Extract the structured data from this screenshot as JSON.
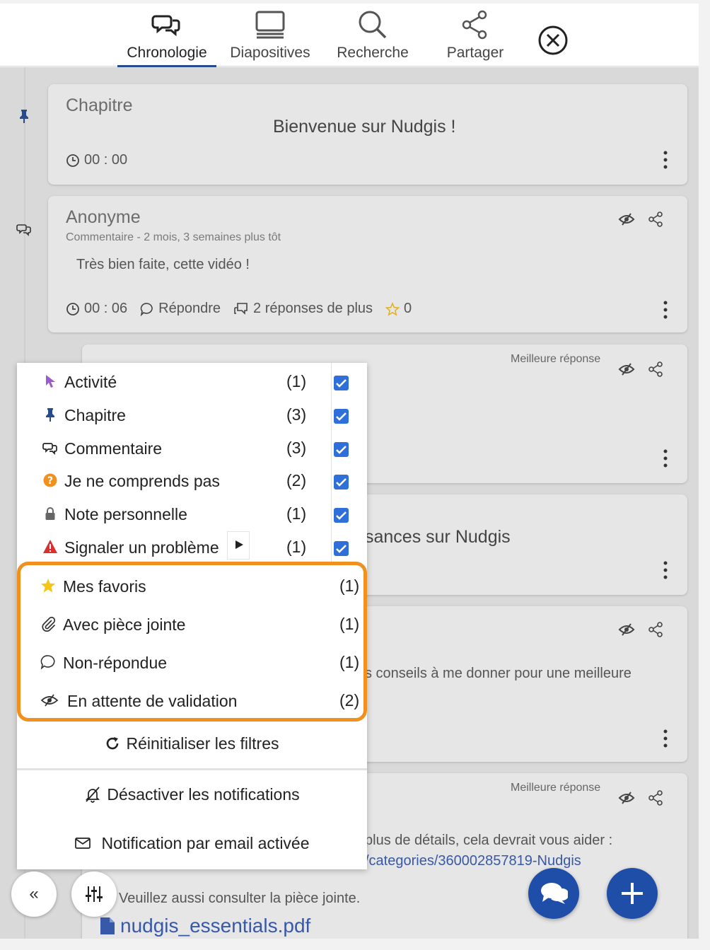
{
  "nav": {
    "tabs": [
      {
        "label": "Chronologie",
        "icon": "chat-bubbles-icon",
        "active": true
      },
      {
        "label": "Diapositives",
        "icon": "slides-icon",
        "active": false
      },
      {
        "label": "Recherche",
        "icon": "search-icon",
        "active": false
      },
      {
        "label": "Partager",
        "icon": "share-icon",
        "active": false
      }
    ],
    "close_icon": "close-circle-icon"
  },
  "cards": [
    {
      "author": "Chapitre",
      "title": "Bienvenue sur Nudgis !",
      "time": "00 : 00"
    },
    {
      "author": "Anonyme",
      "meta": "Commentaire - 2 mois, 3 semaines plus tôt",
      "text": "Très bien faite, cette vidéo !",
      "time": "00 : 06",
      "reply": "Répondre",
      "more_replies": "2 réponses de plus",
      "stars": "0"
    },
    {
      "best_answer": "Meilleure réponse"
    },
    {
      "text_fragment": "sances sur Nudgis"
    },
    {
      "text_fragment": "s conseils à me donner pour une meilleure"
    },
    {
      "best_answer": "Meilleure réponse",
      "text_line1": "plus de détails, cela devrait vous aider :",
      "link_fragment": "/categories/360002857819-Nudgis",
      "text_line3": "Veuillez aussi consulter la pièce jointe.",
      "attachment": "nudgis_essentials.pdf"
    }
  ],
  "filters": {
    "types": [
      {
        "label": "Activité",
        "count": "(1)",
        "icon": "cursor-icon",
        "checked": true
      },
      {
        "label": "Chapitre",
        "count": "(3)",
        "icon": "pin-icon",
        "checked": true
      },
      {
        "label": "Commentaire",
        "count": "(3)",
        "icon": "chat-bubbles-icon",
        "checked": true
      },
      {
        "label": "Je ne comprends pas",
        "count": "(2)",
        "icon": "question-icon",
        "checked": true
      },
      {
        "label": "Note personnelle",
        "count": "(1)",
        "icon": "lock-icon",
        "checked": true
      },
      {
        "label": "Signaler un problème",
        "count": "(1)",
        "icon": "warning-icon",
        "checked": true
      }
    ],
    "special": [
      {
        "label": "Mes favoris",
        "count": "(1)",
        "icon": "star-icon"
      },
      {
        "label": "Avec pièce jointe",
        "count": "(1)",
        "icon": "paperclip-icon"
      },
      {
        "label": "Non-répondue",
        "count": "(1)",
        "icon": "chat-bubble-icon"
      },
      {
        "label": "En attente de validation",
        "count": "(2)",
        "icon": "eye-slash-icon"
      }
    ],
    "reset_label": "Réinitialiser les filtres",
    "disable_notifications_label": "Désactiver les notifications",
    "email_notification_label": "Notification par email activée"
  },
  "colors": {
    "accent": "#1f4ea8",
    "highlight": "#f0901e",
    "checkbox": "#2e6fd9"
  }
}
